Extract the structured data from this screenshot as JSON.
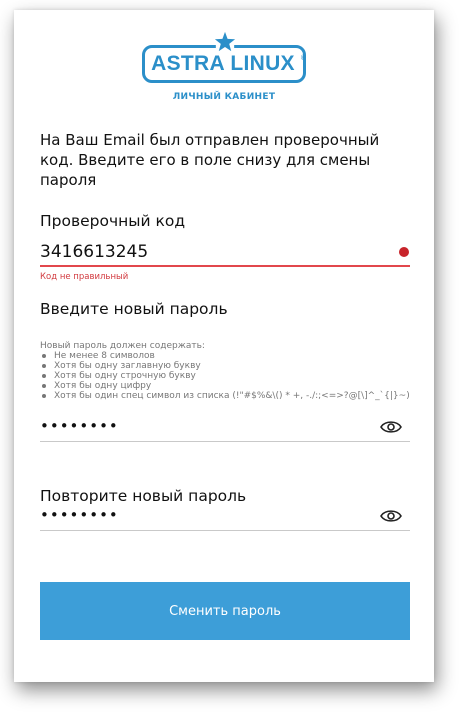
{
  "brand": {
    "logo_text": "ASTRA LINUX",
    "registered": "®",
    "subtitle": "ЛИЧНЫЙ КАБИНЕТ",
    "color": "#2b8fc9"
  },
  "intro_text": "На Ваш Email был отправлен проверочный код. Введите его в поле снизу для смены пароля",
  "code_field": {
    "label": "Проверочный код",
    "value": "3416613245",
    "error": "Код не правильный",
    "error_color": "#e2474c"
  },
  "new_password": {
    "label": "Введите новый пароль",
    "requirements_title": "Новый пароль должен содержать:",
    "requirements": [
      "Не менее 8 символов",
      "Хотя бы одну заглавную букву",
      "Хотя бы одну строчную букву",
      "Хотя бы одну цифру",
      "Хотя бы один спец символ из списка (!\"#$%&\\() * +, -./:;<=>?@[\\]^_`{|}~)"
    ],
    "value": "••••••••",
    "toggle_icon": "eye-icon"
  },
  "repeat_password": {
    "label": "Повторите новый пароль",
    "value": "••••••••",
    "toggle_icon": "eye-icon"
  },
  "submit": {
    "label": "Сменить пароль",
    "color": "#3d9ed8"
  }
}
